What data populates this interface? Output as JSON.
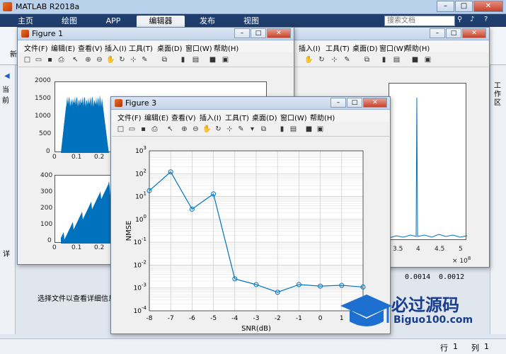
{
  "app": {
    "title": "MATLAB R2018a"
  },
  "ribbon": {
    "tabs": [
      "主页",
      "绘图",
      "APP",
      "编辑器",
      "发布",
      "视图"
    ],
    "active_tab": "编辑器",
    "search_placeholder": "搜索文档"
  },
  "left_pane": {
    "label_new": "新",
    "label_current": "当前",
    "label_detail": "详"
  },
  "right_pane": {
    "label": "工作区"
  },
  "detail_text": "选择文件以查看详细信息",
  "status": {
    "row_label": "行",
    "row_value": "1",
    "col_label": "列",
    "col_value": "1"
  },
  "values_shown": [
    "0.0014",
    "0.0012"
  ],
  "figure_menu": [
    "文件(F)",
    "编辑(E)",
    "查看(V)",
    "插入(I)",
    "工具(T)",
    "桌面(D)",
    "窗口(W)",
    "帮助(H)"
  ],
  "figure1": {
    "title": "Figure 1",
    "top_yticks": [
      "2000",
      "1500",
      "1000",
      "500",
      "0"
    ],
    "top_xticks": [
      "0",
      "0.1",
      "0.2"
    ],
    "bottom_yticks": [
      "400",
      "300",
      "200",
      "100",
      "0"
    ],
    "bottom_xticks": [
      "0",
      "0.1",
      "0.2"
    ]
  },
  "figure2": {
    "menu": [
      "插入(I)",
      "工具(T)",
      "桌面(D)",
      "窗口(W)",
      "帮助(H)"
    ],
    "xticks": [
      "3.5",
      "4",
      "4.5",
      "5"
    ],
    "xscale": "× 10",
    "xscale_exp": "8"
  },
  "figure3": {
    "title": "Figure 3"
  },
  "watermark": {
    "text": "必过源码",
    "sub": "Biguo100.com"
  },
  "chart_data": {
    "type": "line",
    "x": [
      -8,
      -7,
      -6,
      -5,
      -4,
      -3,
      -2,
      -1,
      0,
      1,
      2
    ],
    "y": [
      18,
      120,
      2.8,
      13,
      0.0025,
      0.0014,
      0.00065,
      0.0014,
      0.0012,
      0.0013,
      0.0011
    ],
    "xlabel": "SNR(dB)",
    "ylabel": "NMSE",
    "xlim": [
      -8,
      2
    ],
    "ylim": [
      0.0001,
      1000
    ],
    "yscale": "log",
    "xticks": [
      "-8",
      "-7",
      "-6",
      "-5",
      "-4",
      "-3",
      "-2",
      "-1",
      "0",
      "1"
    ],
    "grid": true,
    "marker": "circle",
    "color": "#0072bd"
  }
}
